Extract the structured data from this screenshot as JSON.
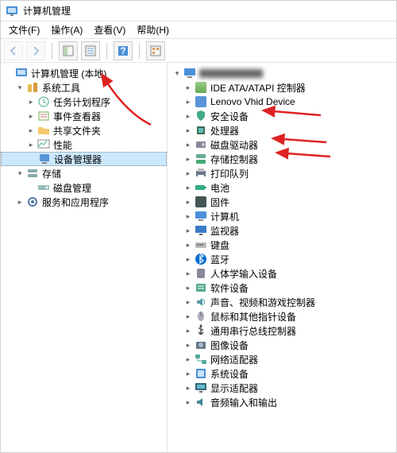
{
  "window": {
    "title": "计算机管理"
  },
  "menu": {
    "file": "文件(F)",
    "action": "操作(A)",
    "view": "查看(V)",
    "help": "帮助(H)"
  },
  "left_tree": {
    "root": "计算机管理 (本地)",
    "system_tools": "系统工具",
    "task_scheduler": "任务计划程序",
    "event_viewer": "事件查看器",
    "shared_folders": "共享文件夹",
    "performance": "性能",
    "device_manager": "设备管理器",
    "storage": "存储",
    "disk_management": "磁盘管理",
    "services_apps": "服务和应用程序"
  },
  "right_tree": {
    "root": "",
    "items": [
      {
        "id": "ide",
        "label": "IDE ATA/ATAPI 控制器",
        "icon": "ide-icon"
      },
      {
        "id": "lenovo",
        "label": "Lenovo Vhid Device",
        "icon": "device-icon"
      },
      {
        "id": "security",
        "label": "安全设备",
        "icon": "security-icon"
      },
      {
        "id": "processor",
        "label": "处理器",
        "icon": "cpu-icon"
      },
      {
        "id": "disk-drive",
        "label": "磁盘驱动器",
        "icon": "disk-icon"
      },
      {
        "id": "storage-ctrl",
        "label": "存储控制器",
        "icon": "storage-icon"
      },
      {
        "id": "print-queue",
        "label": "打印队列",
        "icon": "printer-icon"
      },
      {
        "id": "battery",
        "label": "电池",
        "icon": "battery-icon"
      },
      {
        "id": "firmware",
        "label": "固件",
        "icon": "firmware-icon"
      },
      {
        "id": "computer",
        "label": "计算机",
        "icon": "computer-icon"
      },
      {
        "id": "monitor",
        "label": "监视器",
        "icon": "monitor-icon"
      },
      {
        "id": "keyboard",
        "label": "键盘",
        "icon": "keyboard-icon"
      },
      {
        "id": "bluetooth",
        "label": "蓝牙",
        "icon": "bluetooth-icon"
      },
      {
        "id": "hid",
        "label": "人体学输入设备",
        "icon": "hid-icon"
      },
      {
        "id": "software",
        "label": "软件设备",
        "icon": "software-icon"
      },
      {
        "id": "sound",
        "label": "声音、视频和游戏控制器",
        "icon": "sound-icon"
      },
      {
        "id": "mouse",
        "label": "鼠标和其他指针设备",
        "icon": "mouse-icon"
      },
      {
        "id": "usb",
        "label": "通用串行总线控制器",
        "icon": "usb-icon"
      },
      {
        "id": "imaging",
        "label": "图像设备",
        "icon": "camera-icon"
      },
      {
        "id": "network",
        "label": "网络适配器",
        "icon": "network-icon"
      },
      {
        "id": "system",
        "label": "系统设备",
        "icon": "system-icon"
      },
      {
        "id": "display",
        "label": "显示适配器",
        "icon": "display-icon"
      },
      {
        "id": "audio-io",
        "label": "音频输入和输出",
        "icon": "audio-icon"
      }
    ]
  }
}
